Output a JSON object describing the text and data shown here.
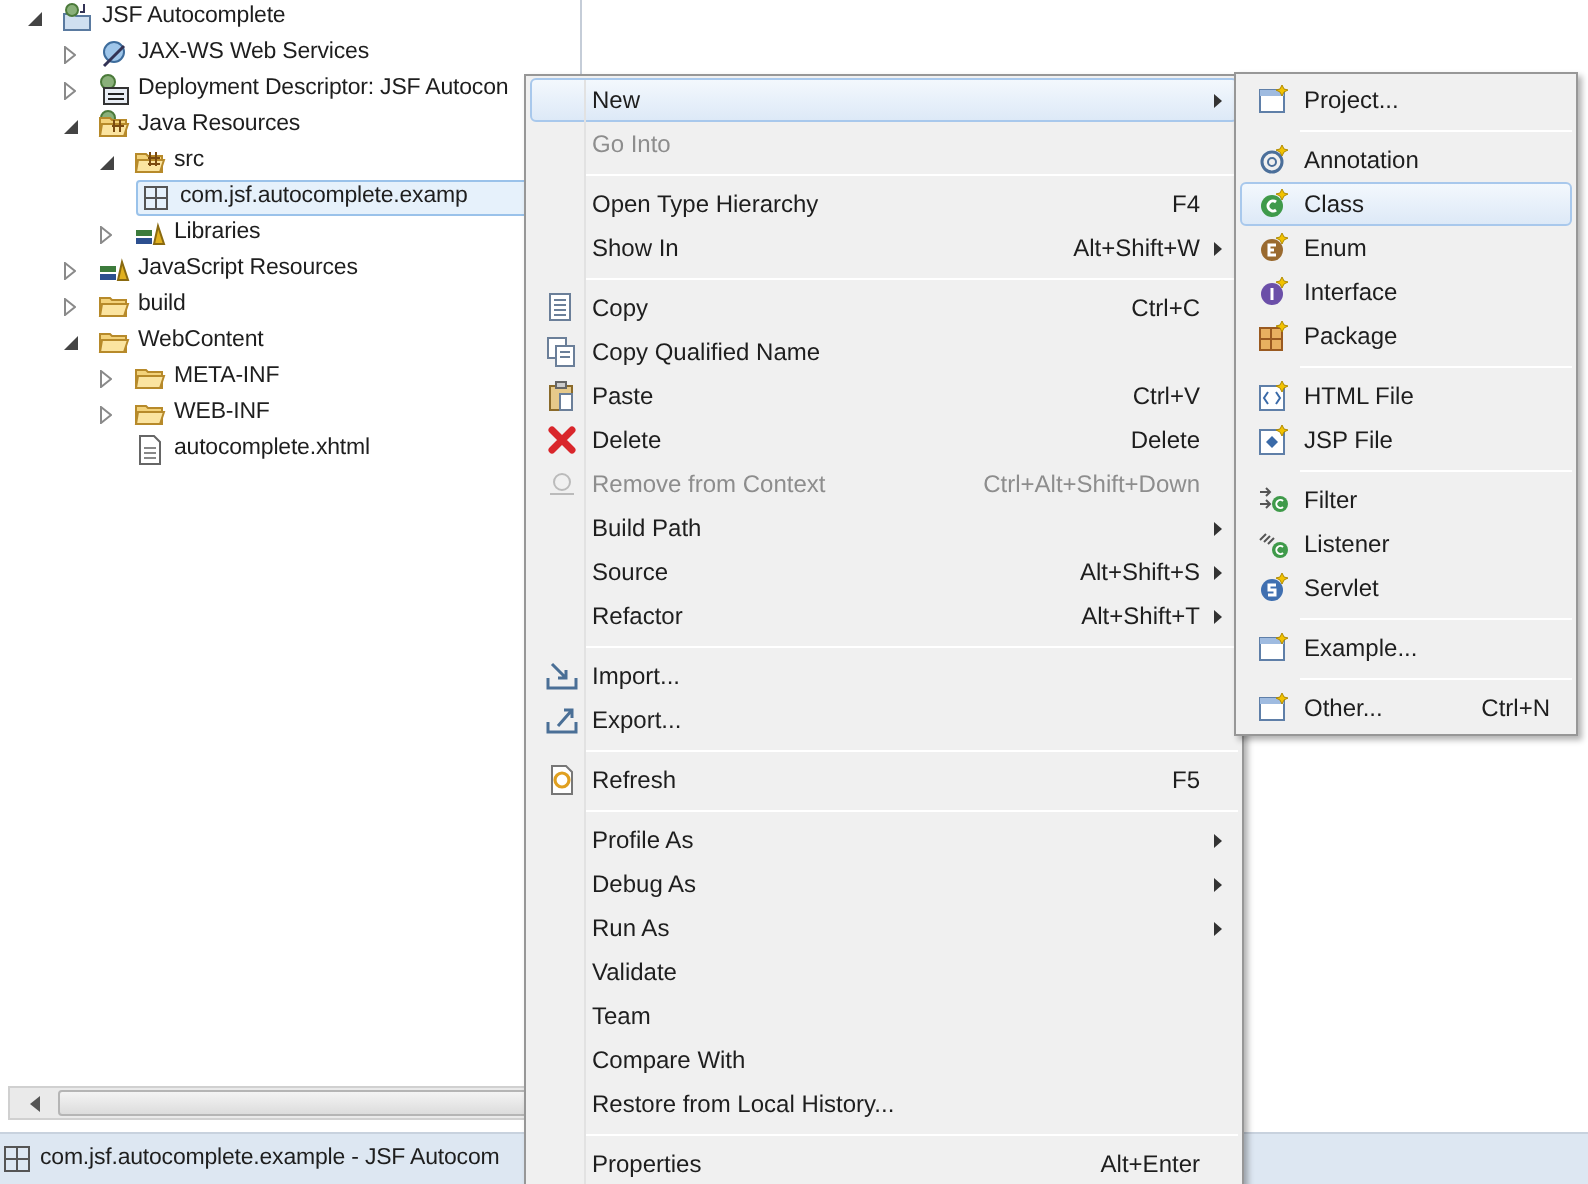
{
  "project_tree": [
    {
      "label": "JSF Autocomplete",
      "kind": "project",
      "expanded": true,
      "selected": false,
      "children": [
        {
          "label": "JAX-WS Web Services",
          "kind": "webservices",
          "expanded": false,
          "selected": false
        },
        {
          "label": "Deployment Descriptor: JSF Autocon",
          "kind": "descriptor",
          "expanded": false,
          "selected": false
        },
        {
          "label": "Java Resources",
          "kind": "javaresources",
          "expanded": true,
          "selected": false,
          "children": [
            {
              "label": "src",
              "kind": "sourcefolder",
              "expanded": true,
              "selected": false,
              "children": [
                {
                  "label": "com.jsf.autocomplete.examp",
                  "kind": "package",
                  "selected": true
                }
              ]
            },
            {
              "label": "Libraries",
              "kind": "library",
              "expanded": false,
              "selected": false
            }
          ]
        },
        {
          "label": "JavaScript Resources",
          "kind": "library",
          "expanded": false,
          "selected": false
        },
        {
          "label": "build",
          "kind": "folder",
          "expanded": false,
          "selected": false
        },
        {
          "label": "WebContent",
          "kind": "folder",
          "expanded": true,
          "selected": false,
          "children": [
            {
              "label": "META-INF",
              "kind": "folder",
              "expanded": false,
              "selected": false
            },
            {
              "label": "WEB-INF",
              "kind": "folder",
              "expanded": false,
              "selected": false
            },
            {
              "label": "autocomplete.xhtml",
              "kind": "file",
              "selected": false
            }
          ]
        }
      ]
    }
  ],
  "context_menu": {
    "groups": [
      [
        {
          "label": "New",
          "selected": true,
          "disabled": false,
          "submenu": true
        },
        {
          "label": "Go Into",
          "selected": false,
          "disabled": true,
          "submenu": false
        }
      ],
      [
        {
          "label": "Open Type Hierarchy",
          "shortcut": "F4",
          "selected": false,
          "disabled": false,
          "submenu": false
        },
        {
          "label": "Show In",
          "shortcut": "Alt+Shift+W",
          "selected": false,
          "disabled": false,
          "submenu": true
        }
      ],
      [
        {
          "label": "Copy",
          "shortcut": "Ctrl+C",
          "kind": "copy",
          "selected": false,
          "disabled": false,
          "submenu": false
        },
        {
          "label": "Copy Qualified Name",
          "kind": "copyname",
          "selected": false,
          "disabled": false,
          "submenu": false
        },
        {
          "label": "Paste",
          "shortcut": "Ctrl+V",
          "kind": "paste",
          "selected": false,
          "disabled": false,
          "submenu": false
        },
        {
          "label": "Delete",
          "shortcut": "Delete",
          "kind": "delete",
          "selected": false,
          "disabled": false,
          "submenu": false
        },
        {
          "label": "Remove from Context",
          "shortcut": "Ctrl+Alt+Shift+Down",
          "kind": "remove",
          "selected": false,
          "disabled": true,
          "submenu": false
        },
        {
          "label": "Build Path",
          "selected": false,
          "disabled": false,
          "submenu": true
        },
        {
          "label": "Source",
          "shortcut": "Alt+Shift+S",
          "selected": false,
          "disabled": false,
          "submenu": true
        },
        {
          "label": "Refactor",
          "shortcut": "Alt+Shift+T",
          "selected": false,
          "disabled": false,
          "submenu": true
        }
      ],
      [
        {
          "label": "Import...",
          "kind": "import",
          "selected": false,
          "disabled": false,
          "submenu": false
        },
        {
          "label": "Export...",
          "kind": "export",
          "selected": false,
          "disabled": false,
          "submenu": false
        }
      ],
      [
        {
          "label": "Refresh",
          "shortcut": "F5",
          "kind": "refresh",
          "selected": false,
          "disabled": false,
          "submenu": false
        }
      ],
      [
        {
          "label": "Profile As",
          "selected": false,
          "disabled": false,
          "submenu": true
        },
        {
          "label": "Debug As",
          "selected": false,
          "disabled": false,
          "submenu": true
        },
        {
          "label": "Run As",
          "selected": false,
          "disabled": false,
          "submenu": true
        },
        {
          "label": "Validate",
          "selected": false,
          "disabled": false,
          "submenu": false
        },
        {
          "label": "Team",
          "selected": false,
          "disabled": false,
          "submenu": false
        },
        {
          "label": "Compare With",
          "selected": false,
          "disabled": false,
          "submenu": false
        },
        {
          "label": "Restore from Local History...",
          "selected": false,
          "disabled": false,
          "submenu": false
        }
      ],
      [
        {
          "label": "Properties",
          "shortcut": "Alt+Enter",
          "selected": false,
          "disabled": false,
          "submenu": false
        }
      ]
    ]
  },
  "new_submenu": {
    "groups": [
      [
        {
          "label": "Project...",
          "kind": "wizard",
          "selected": false
        }
      ],
      [
        {
          "label": "Annotation",
          "kind": "annotation",
          "selected": false
        },
        {
          "label": "Class",
          "kind": "class",
          "selected": true
        },
        {
          "label": "Enum",
          "kind": "enum",
          "selected": false
        },
        {
          "label": "Interface",
          "kind": "interface",
          "selected": false
        },
        {
          "label": "Package",
          "kind": "package",
          "selected": false
        }
      ],
      [
        {
          "label": "HTML File",
          "kind": "html",
          "selected": false
        },
        {
          "label": "JSP File",
          "kind": "jsp",
          "selected": false
        }
      ],
      [
        {
          "label": "Filter",
          "kind": "filter",
          "selected": false
        },
        {
          "label": "Listener",
          "kind": "listener",
          "selected": false
        },
        {
          "label": "Servlet",
          "kind": "servlet",
          "selected": false
        }
      ],
      [
        {
          "label": "Example...",
          "kind": "wizard",
          "selected": false
        }
      ],
      [
        {
          "label": "Other...",
          "shortcut": "Ctrl+N",
          "kind": "wizard",
          "selected": false
        }
      ]
    ]
  },
  "status_bar": {
    "text": "com.jsf.autocomplete.example - JSF Autocom"
  }
}
